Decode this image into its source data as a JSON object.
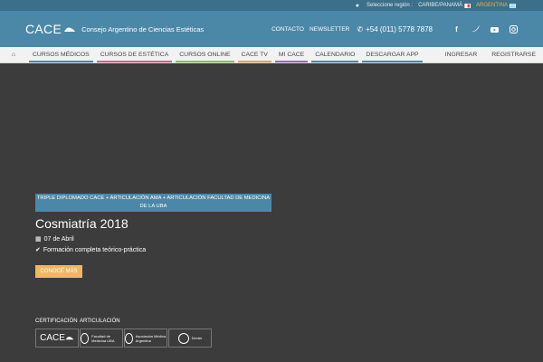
{
  "region_bar": {
    "label": "Seleccione región :",
    "regions": [
      "CARIBE/PANAMÁ",
      "ARGENTINA"
    ]
  },
  "header": {
    "logo_text": "CACE",
    "org_name": "Consejo Argentino de Ciencias Estéticas",
    "links": [
      "CONTACTO",
      "NEWSLETTER"
    ],
    "phone": "+54 (011) 5778 7878",
    "social": [
      "facebook-icon",
      "twitter-icon",
      "youtube-icon",
      "instagram-icon"
    ]
  },
  "nav": {
    "items": [
      {
        "label": "CURSOS MÉDICOS",
        "color": "#4b88a7"
      },
      {
        "label": "CURSOS DE ESTÉTICA",
        "color": "#e05a8c"
      },
      {
        "label": "CURSOS ONLINE",
        "color": "#8cc63f"
      },
      {
        "label": "CACE TV",
        "color": "#f0a040"
      },
      {
        "label": "MI CACE",
        "color": "#9a6bb5"
      },
      {
        "label": "CALENDARIO",
        "color": "#4b88a7"
      },
      {
        "label": "DESCARGAR APP",
        "color": "#4b88a7"
      }
    ],
    "right": [
      "INGRESAR",
      "REGISTRARSE"
    ]
  },
  "hero": {
    "tag": "TRIPLE DIPLOMADO CACE + ARTICULACIÓN AMA + ARTICULACIÓN FACULTAD DE MEDICINA DE LA UBA",
    "title": "Cosmiatría 2018",
    "date": "07 de Abril",
    "feature": "Formación completa teórico-práctica",
    "cta": "CONOCÉ MÁS"
  },
  "certification": {
    "cert_label": "CERTIFICACIÓN",
    "art_label": "ARTICULACIÓN",
    "logos": {
      "cace": "CACE",
      "uba": "Facultad de Medicina UBA",
      "ama": "Asociación Médica Argentina",
      "dexter": "Dexter"
    }
  },
  "colors": {
    "accent": "#4b88a7",
    "cta": "#efb663",
    "background": "#3c3c3c"
  }
}
